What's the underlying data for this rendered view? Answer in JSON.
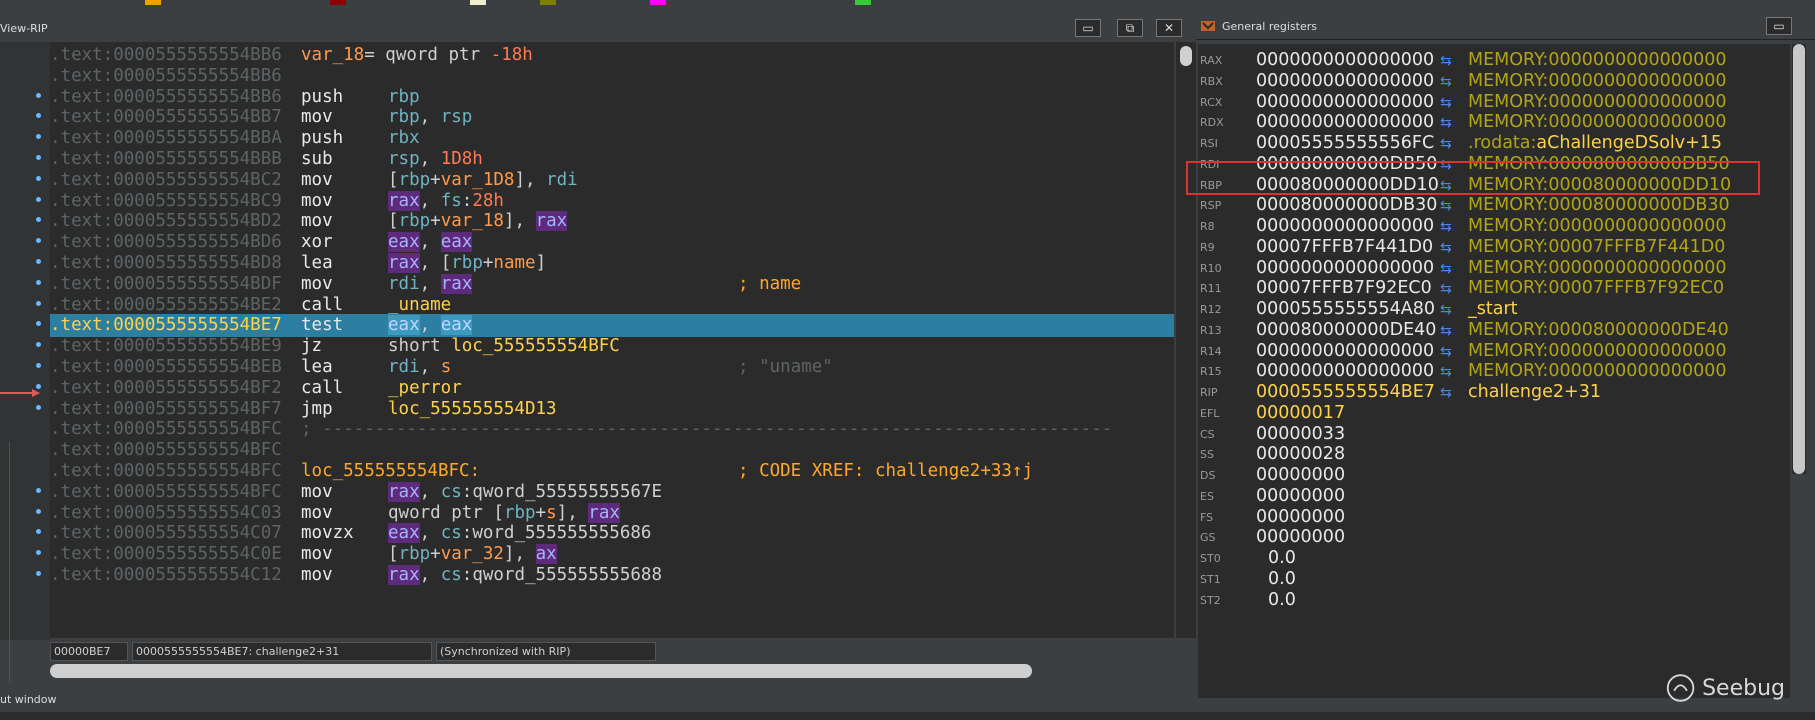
{
  "legend": {
    "colors": [
      "#f0a000",
      "#8b0000",
      "#eeeecc",
      "#808000",
      "#ff00ff",
      "#33cc33"
    ]
  },
  "left": {
    "title": "View-RIP",
    "buttons": {
      "restore": "▭",
      "float": "⧉",
      "close": "✕"
    },
    "code_lines": [
      {
        "addr": ".text:0000555555554BB6",
        "kind": "vardef",
        "label": "var_18",
        "text": "= qword ptr ",
        "num": "-18h"
      },
      {
        "addr": ".text:0000555555554BB6",
        "kind": "blank"
      },
      {
        "addr": ".text:0000555555554BB6",
        "kind": "insn",
        "mnem": "push",
        "ops": "rbp"
      },
      {
        "addr": ".text:0000555555554BB7",
        "kind": "insn",
        "mnem": "mov",
        "ops": "rbp, rsp"
      },
      {
        "addr": ".text:0000555555554BBA",
        "kind": "insn",
        "mnem": "push",
        "ops": "rbx"
      },
      {
        "addr": ".text:0000555555554BBB",
        "kind": "insn",
        "mnem": "sub",
        "ops": "rsp, 1D8h"
      },
      {
        "addr": ".text:0000555555554BC2",
        "kind": "insn",
        "mnem": "mov",
        "ops": "[rbp+var_1D8], rdi"
      },
      {
        "addr": ".text:0000555555554BC9",
        "kind": "insn",
        "mnem": "mov",
        "ops": "rax, fs:28h"
      },
      {
        "addr": ".text:0000555555554BD2",
        "kind": "insn",
        "mnem": "mov",
        "ops": "[rbp+var_18], rax"
      },
      {
        "addr": ".text:0000555555554BD6",
        "kind": "insn",
        "mnem": "xor",
        "ops": "eax, eax"
      },
      {
        "addr": ".text:0000555555554BD8",
        "kind": "insn",
        "mnem": "lea",
        "ops": "rax, [rbp+name]"
      },
      {
        "addr": ".text:0000555555554BDF",
        "kind": "insn",
        "mnem": "mov",
        "ops": "rdi, rax",
        "comment": "; name"
      },
      {
        "addr": ".text:0000555555554BE2",
        "kind": "insn",
        "mnem": "call",
        "ops": "_uname"
      },
      {
        "addr": ".text:0000555555554BE7",
        "kind": "insn",
        "mnem": "test",
        "ops": "eax, eax",
        "current": true
      },
      {
        "addr": ".text:0000555555554BE9",
        "kind": "insn",
        "mnem": "jz",
        "ops": "short loc_555555554BFC"
      },
      {
        "addr": ".text:0000555555554BEB",
        "kind": "insn",
        "mnem": "lea",
        "ops": "rdi, s",
        "comment": "; \"uname\"",
        "comment_dim": true
      },
      {
        "addr": ".text:0000555555554BF2",
        "kind": "insn",
        "mnem": "call",
        "ops": "_perror"
      },
      {
        "addr": ".text:0000555555554BF7",
        "kind": "insn",
        "mnem": "jmp",
        "ops": "loc_555555554D13"
      },
      {
        "addr": ".text:0000555555554BFC",
        "kind": "sep",
        "text": "; ---------------------------------------------------------------------------"
      },
      {
        "addr": ".text:0000555555554BFC",
        "kind": "blank"
      },
      {
        "addr": ".text:0000555555554BFC",
        "kind": "label",
        "label": "loc_555555554BFC:",
        "comment": "; CODE XREF: challenge2+33↑j"
      },
      {
        "addr": ".text:0000555555554BFC",
        "kind": "insn",
        "mnem": "mov",
        "ops": "rax, cs:qword_55555555567E"
      },
      {
        "addr": ".text:0000555555554C03",
        "kind": "insn",
        "mnem": "mov",
        "ops": "qword ptr [rbp+s], rax"
      },
      {
        "addr": ".text:0000555555554C07",
        "kind": "insn",
        "mnem": "movzx",
        "ops": "eax, cs:word_555555555686"
      },
      {
        "addr": ".text:0000555555554C0E",
        "kind": "insn",
        "mnem": "mov",
        "ops": "[rbp+var_32], ax"
      },
      {
        "addr": ".text:0000555555554C12",
        "kind": "insn",
        "mnem": "mov",
        "ops": "rax, cs:qword_555555555688"
      }
    ],
    "status": {
      "offset": "00000BE7",
      "location": "0000555555554BE7: challenge2+31",
      "sync": "(Synchronized with RIP)"
    }
  },
  "output_label": "ut window",
  "right": {
    "title": "General registers",
    "registers": [
      {
        "name": "RAX",
        "value": "0000000000000000",
        "desc": "MEMORY:0000000000000000",
        "type": "mem"
      },
      {
        "name": "RBX",
        "value": "0000000000000000",
        "desc": "MEMORY:0000000000000000",
        "type": "mem"
      },
      {
        "name": "RCX",
        "value": "0000000000000000",
        "desc": "MEMORY:0000000000000000",
        "type": "mem"
      },
      {
        "name": "RDX",
        "value": "0000000000000000",
        "desc": "MEMORY:0000000000000000",
        "type": "mem"
      },
      {
        "name": "RSI",
        "value": "00005555555556FC",
        "desc": ".rodata:aChallengeDSolv+15",
        "type": "rodata"
      },
      {
        "name": "RDI",
        "value": "000080000000DB50",
        "desc": "MEMORY:000080000000DB50",
        "type": "mem"
      },
      {
        "name": "RBP",
        "value": "000080000000DD10",
        "desc": "MEMORY:000080000000DD10",
        "type": "mem"
      },
      {
        "name": "RSP",
        "value": "000080000000DB30",
        "desc": "MEMORY:000080000000DB30",
        "type": "mem"
      },
      {
        "name": "R8",
        "value": "0000000000000000",
        "desc": "MEMORY:0000000000000000",
        "type": "mem"
      },
      {
        "name": "R9",
        "value": "00007FFFB7F441D0",
        "desc": "MEMORY:00007FFFB7F441D0",
        "type": "mem"
      },
      {
        "name": "R10",
        "value": "0000000000000000",
        "desc": "MEMORY:0000000000000000",
        "type": "mem"
      },
      {
        "name": "R11",
        "value": "00007FFFB7F92EC0",
        "desc": "MEMORY:00007FFFB7F92EC0",
        "type": "mem"
      },
      {
        "name": "R12",
        "value": "0000555555554A80",
        "desc": "_start",
        "type": "sym"
      },
      {
        "name": "R13",
        "value": "000080000000DE40",
        "desc": "MEMORY:000080000000DE40",
        "type": "mem"
      },
      {
        "name": "R14",
        "value": "0000000000000000",
        "desc": "MEMORY:0000000000000000",
        "type": "mem"
      },
      {
        "name": "R15",
        "value": "0000000000000000",
        "desc": "MEMORY:0000000000000000",
        "type": "mem"
      },
      {
        "name": "RIP",
        "value": "0000555555554BE7",
        "desc": "challenge2+31",
        "type": "sym"
      },
      {
        "name": "EFL",
        "value": "00000017",
        "desc": "",
        "type": "flag"
      },
      {
        "name": "CS",
        "value": "00000033",
        "desc": "",
        "type": "plain"
      },
      {
        "name": "SS",
        "value": "00000028",
        "desc": "",
        "type": "plain"
      },
      {
        "name": "DS",
        "value": "00000000",
        "desc": "",
        "type": "plain"
      },
      {
        "name": "ES",
        "value": "00000000",
        "desc": "",
        "type": "plain"
      },
      {
        "name": "FS",
        "value": "00000000",
        "desc": "",
        "type": "plain"
      },
      {
        "name": "GS",
        "value": "00000000",
        "desc": "",
        "type": "plain"
      },
      {
        "name": "ST0",
        "value": "0.0",
        "desc": "",
        "type": "st"
      },
      {
        "name": "ST1",
        "value": "0.0",
        "desc": "",
        "type": "st"
      },
      {
        "name": "ST2",
        "value": "0.0",
        "desc": "",
        "type": "st"
      }
    ]
  },
  "watermark": "Seebug"
}
